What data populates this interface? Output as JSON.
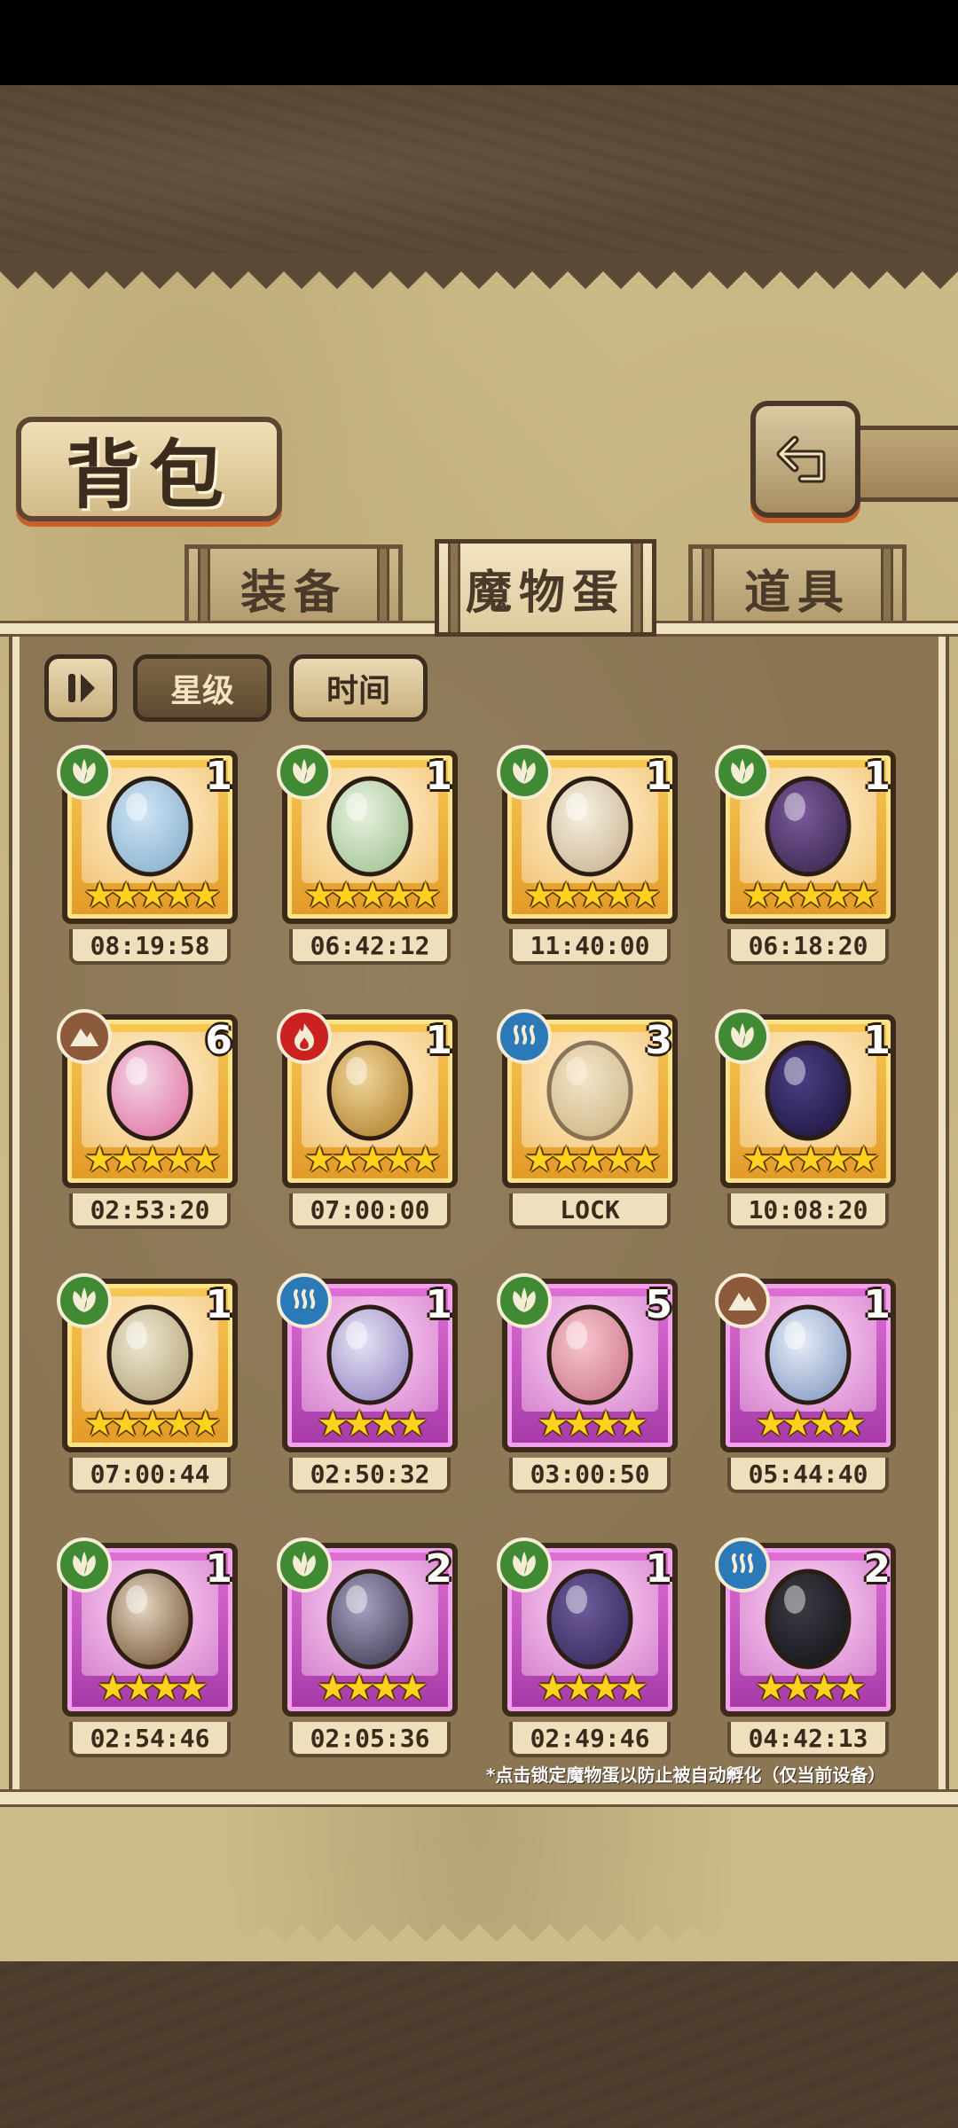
{
  "title": "背包",
  "tabs": [
    {
      "label": "装备",
      "active": false
    },
    {
      "label": "魔物蛋",
      "active": true
    },
    {
      "label": "道具",
      "active": false
    }
  ],
  "filters": [
    {
      "label": "星级",
      "active": true
    },
    {
      "label": "时间",
      "active": false
    }
  ],
  "eggs": [
    {
      "element": "nature",
      "count": "1",
      "stars": "★★★★★",
      "timer": "08:19:58",
      "rarity": "gold",
      "art": "pocket-watch-egg"
    },
    {
      "element": "nature",
      "count": "1",
      "stars": "★★★★★",
      "timer": "06:42:12",
      "rarity": "gold",
      "art": "leafy-white-egg"
    },
    {
      "element": "nature",
      "count": "1",
      "stars": "★★★★★",
      "timer": "11:40:00",
      "rarity": "gold",
      "art": "winged-crown-egg"
    },
    {
      "element": "nature",
      "count": "1",
      "stars": "★★★★★",
      "timer": "06:18:20",
      "rarity": "gold",
      "art": "magic-lamp-egg"
    },
    {
      "element": "earth",
      "count": "6",
      "stars": "★★★★★",
      "timer": "02:53:20",
      "rarity": "gold",
      "art": "heart-bow-egg"
    },
    {
      "element": "fire",
      "count": "1",
      "stars": "★★★★★",
      "timer": "07:00:00",
      "rarity": "gold",
      "art": "tiger-stripe-egg"
    },
    {
      "element": "water",
      "count": "3",
      "stars": "★★★★★",
      "timer": "LOCK",
      "rarity": "gold",
      "art": "locked-heart-egg"
    },
    {
      "element": "nature",
      "count": "1",
      "stars": "★★★★★",
      "timer": "10:08:20",
      "rarity": "gold",
      "art": "crystal-dark-egg"
    },
    {
      "element": "nature",
      "count": "1",
      "stars": "★★★★★",
      "timer": "07:00:44",
      "rarity": "gold",
      "art": "onion-egg"
    },
    {
      "element": "water",
      "count": "1",
      "stars": "★★★★",
      "timer": "02:50:32",
      "rarity": "purple",
      "art": "feather-egg"
    },
    {
      "element": "nature",
      "count": "5",
      "stars": "★★★★",
      "timer": "03:00:50",
      "rarity": "purple",
      "art": "pink-pig-egg"
    },
    {
      "element": "earth",
      "count": "1",
      "stars": "★★★★",
      "timer": "05:44:40",
      "rarity": "purple",
      "art": "orb-egg"
    },
    {
      "element": "nature",
      "count": "1",
      "stars": "★★★★",
      "timer": "02:54:46",
      "rarity": "purple",
      "art": "striped-egg"
    },
    {
      "element": "nature",
      "count": "2",
      "stars": "★★★★",
      "timer": "02:05:36",
      "rarity": "purple",
      "art": "studded-egg"
    },
    {
      "element": "nature",
      "count": "1",
      "stars": "★★★★",
      "timer": "02:49:46",
      "rarity": "purple",
      "art": "moth-egg"
    },
    {
      "element": "water",
      "count": "2",
      "stars": "★★★★",
      "timer": "04:42:13",
      "rarity": "purple",
      "art": "shark-egg"
    }
  ],
  "footnote": "*点击锁定魔物蛋以防止被自动孵化（仅当前设备）",
  "icons": {
    "back": "return-arrow-icon",
    "sort": "sort-toggle-icon",
    "nature": "leaf-icon",
    "earth": "mountain-icon",
    "fire": "flame-icon",
    "water": "wave-icon"
  }
}
